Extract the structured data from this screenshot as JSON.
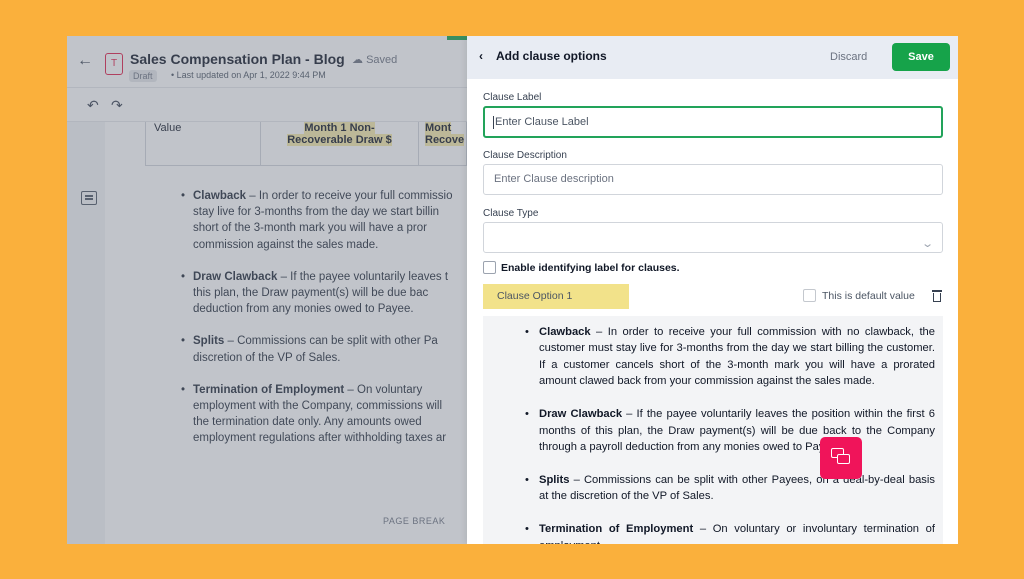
{
  "editor": {
    "doc_icon_letter": "T",
    "title": "Sales Compensation Plan - Blog",
    "saved_status": "Saved",
    "draft_badge": "Draft",
    "last_updated": "Last updated on Apr 1, 2022 9:44 PM",
    "table": {
      "value_label": "Value",
      "col1": "Month 1 Non-Recoverable Draw $",
      "col2": "Mont Recove"
    },
    "bullets": [
      {
        "bold": "Clawback",
        "lines": [
          "– In order to receive your full commissio",
          "stay live for 3-months from the day we start billin",
          "short of the 3-month mark you will have a pror",
          "commission against the sales made."
        ]
      },
      {
        "bold": "Draw Clawback",
        "lines": [
          "– If the payee voluntarily leaves t",
          "this plan, the Draw payment(s) will be due bac",
          "deduction from any monies owed to Payee."
        ]
      },
      {
        "bold": "Splits",
        "lines": [
          "– Commissions can be split with other Pa",
          "discretion of the VP of Sales."
        ]
      },
      {
        "bold": "Termination of Employment",
        "lines": [
          "– On voluntary",
          "employment with the Company, commissions will",
          "the termination date only. Any amounts owed",
          "employment regulations after withholding taxes ar"
        ]
      }
    ],
    "page_break": "PAGE BREAK"
  },
  "panel": {
    "title": "Add clause options",
    "discard_label": "Discard",
    "save_label": "Save",
    "clause_label": {
      "label": "Clause Label",
      "placeholder": "Enter Clause Label"
    },
    "clause_description": {
      "label": "Clause Description",
      "placeholder": "Enter Clause description"
    },
    "clause_type": {
      "label": "Clause Type",
      "value": ""
    },
    "identifying_label_checkbox": {
      "label": "Enable identifying label for clauses.",
      "checked": false
    },
    "option": {
      "name": "Clause Option 1",
      "default_label": "This is default value",
      "default_checked": false
    },
    "preview_bullets": [
      {
        "bold": "Clawback",
        "text": " – In order to receive your full commission with no clawback, the customer must stay live for 3-months from the day we start billing the customer. If a customer cancels short of the 3-month mark you will have a prorated amount clawed back from your commission against the sales made."
      },
      {
        "bold": "Draw Clawback",
        "text": " – If the payee voluntarily leaves the position within the first 6 months of this plan, the Draw payment(s) will be due back to the Company through a payroll deduction from any monies owed to Payee."
      },
      {
        "bold": "Splits",
        "text": " – Commissions can be split with other Payees, on a deal-by-deal basis at the discretion of the VP of Sales."
      },
      {
        "bold": "Termination of Employment",
        "text": " – On voluntary or involuntary termination of employment"
      }
    ]
  },
  "colors": {
    "background": "#FAB03C",
    "save_green": "#16A34A",
    "chat_pink": "#F0145A",
    "option_highlight": "#F2E28A"
  }
}
